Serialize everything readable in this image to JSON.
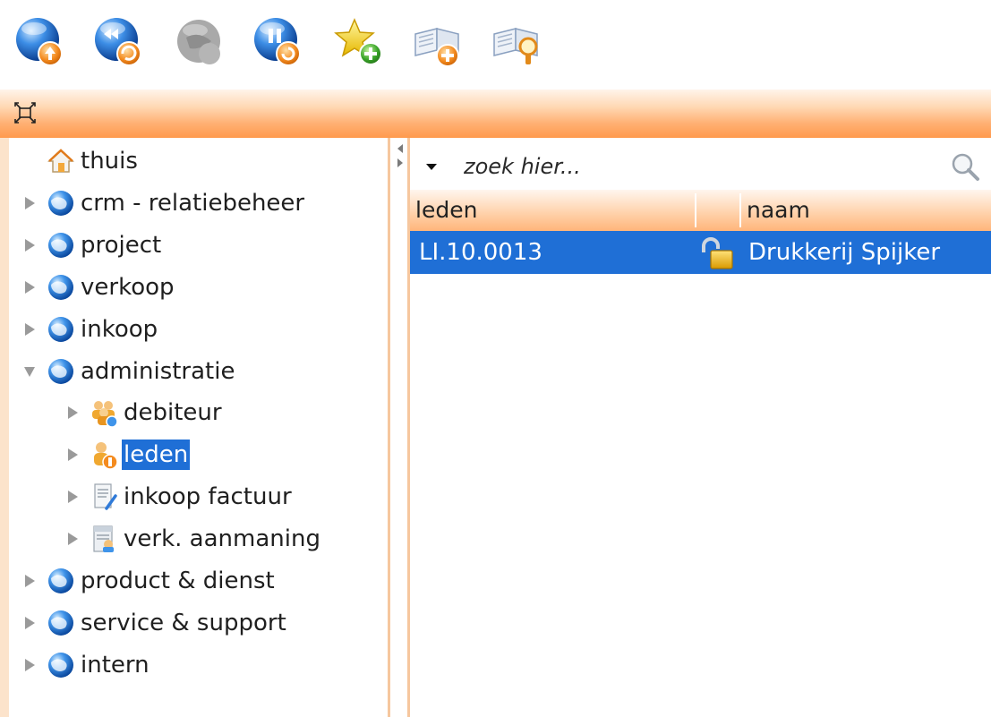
{
  "toolbar": {
    "buttons": [
      {
        "name": "globe-upload-icon"
      },
      {
        "name": "globe-refresh-icon"
      },
      {
        "name": "globe-disabled-icon"
      },
      {
        "name": "globe-pause-icon"
      },
      {
        "name": "star-add-icon"
      },
      {
        "name": "book-add-icon"
      },
      {
        "name": "book-search-icon"
      }
    ]
  },
  "titlebar": {
    "collapse_icon": "collapse-arrows-icon"
  },
  "nav": {
    "items": [
      {
        "label": "thuis",
        "icon": "home-icon",
        "expander": "none",
        "level": 0
      },
      {
        "label": "crm - relatiebeheer",
        "icon": "globe-icon",
        "expander": "collapsed",
        "level": 0
      },
      {
        "label": "project",
        "icon": "globe-icon",
        "expander": "collapsed",
        "level": 0
      },
      {
        "label": "verkoop",
        "icon": "globe-icon",
        "expander": "collapsed",
        "level": 0
      },
      {
        "label": "inkoop",
        "icon": "globe-icon",
        "expander": "collapsed",
        "level": 0
      },
      {
        "label": "administratie",
        "icon": "globe-icon",
        "expander": "expanded",
        "level": 0
      },
      {
        "label": "debiteur",
        "icon": "users-icon",
        "expander": "collapsed",
        "level": 1
      },
      {
        "label": "leden",
        "icon": "member-icon",
        "expander": "collapsed",
        "level": 1,
        "selected": true
      },
      {
        "label": "inkoop factuur",
        "icon": "invoice-icon",
        "expander": "collapsed",
        "level": 1
      },
      {
        "label": "verk. aanmaning",
        "icon": "reminder-icon",
        "expander": "collapsed",
        "level": 1
      },
      {
        "label": "product & dienst",
        "icon": "globe-icon",
        "expander": "collapsed",
        "level": 0
      },
      {
        "label": "service & support",
        "icon": "globe-icon",
        "expander": "collapsed",
        "level": 0
      },
      {
        "label": "intern",
        "icon": "globe-icon",
        "expander": "collapsed",
        "level": 0
      }
    ]
  },
  "search": {
    "placeholder": "zoek hier...",
    "value": ""
  },
  "grid": {
    "columns": [
      "leden",
      "",
      "naam"
    ],
    "rows": [
      {
        "leden": "LI.10.0013",
        "status_icon": "lock-open-icon",
        "naam": "Drukkerij Spijker",
        "selected": true
      }
    ]
  },
  "colors": {
    "accent_orange": "#ff9a4d",
    "selection_blue": "#1f6fd6",
    "border_orange": "#f6c79e"
  }
}
